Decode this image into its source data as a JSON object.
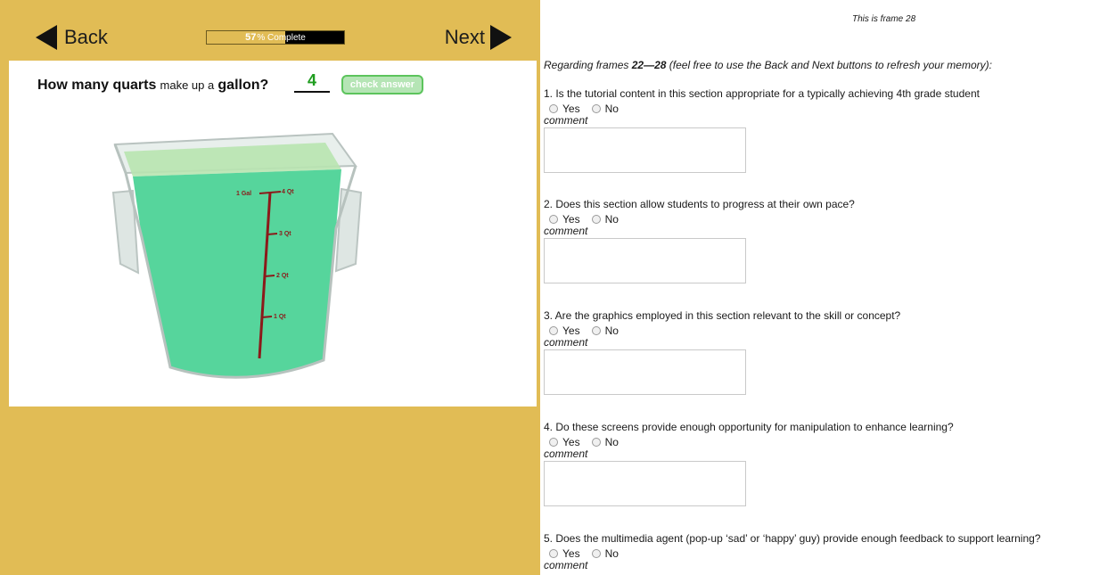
{
  "nav": {
    "back_label": "Back",
    "next_label": "Next"
  },
  "progress": {
    "percent": 57,
    "percent_label": "57",
    "suffix": "% Complete"
  },
  "tutorial": {
    "question_part1": "How many quarts",
    "question_part2": "make up a",
    "question_part3": "gallon?",
    "answer_value": "4",
    "check_button_label": "check answer",
    "marks": {
      "gal": "1 Gal",
      "q4": "4 Qt",
      "q3": "3 Qt",
      "q2": "2 Qt",
      "q1": "1 Qt"
    }
  },
  "survey": {
    "frame_label": "This is frame 28",
    "intro_prefix": "Regarding frames",
    "intro_frames": "22—28",
    "intro_suffix": "(feel free to use the Back and Next buttons to refresh your memory):",
    "yes_label": "Yes",
    "no_label": "No",
    "comment_label": "comment",
    "questions": [
      {
        "text": "1. Is the tutorial content in this section appropriate for a typically achieving 4th grade student"
      },
      {
        "text": "2. Does this section allow students to progress at their own pace?"
      },
      {
        "text": "3. Are the graphics employed in this section relevant to the skill or concept?"
      },
      {
        "text": "4. Do these screens provide enough opportunity for manipulation to enhance learning?"
      },
      {
        "text": "5. Does the multimedia agent (pop-up ‘sad’ or ‘happy’ guy) provide enough feedback to support learning?"
      }
    ]
  },
  "colors": {
    "panel": "#e1bc55",
    "water": "#3fcf8e",
    "measure_line": "#8b1a1a",
    "answer": "#1f9d1f"
  }
}
